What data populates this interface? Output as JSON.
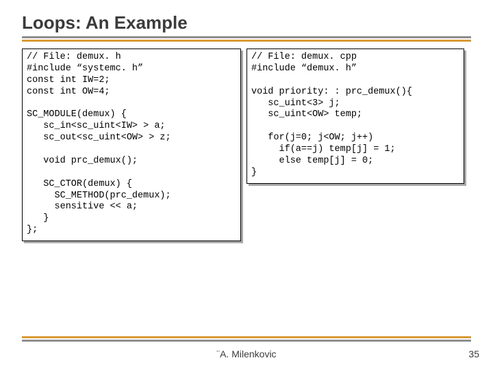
{
  "title": "Loops: An Example",
  "code_left": "// File: demux. h\n#include “systemc. h”\nconst int IW=2;\nconst int OW=4;\n\nSC_MODULE(demux) {\n   sc_in<sc_uint<IW> > a;\n   sc_out<sc_uint<OW> > z;\n\n   void prc_demux();\n\n   SC_CTOR(demux) {\n     SC_METHOD(prc_demux);\n     sensitive << a;\n   }\n};",
  "code_right": "// File: demux. cpp\n#include “demux. h”\n\nvoid priority: : prc_demux(){\n   sc_uint<3> j;\n   sc_uint<OW> temp;\n\n   for(j=0; j<OW; j++)\n     if(a==j) temp[j] = 1;\n     else temp[j] = 0;\n}",
  "footer": {
    "credit": "¨A. Milenkovic",
    "page": "35"
  }
}
